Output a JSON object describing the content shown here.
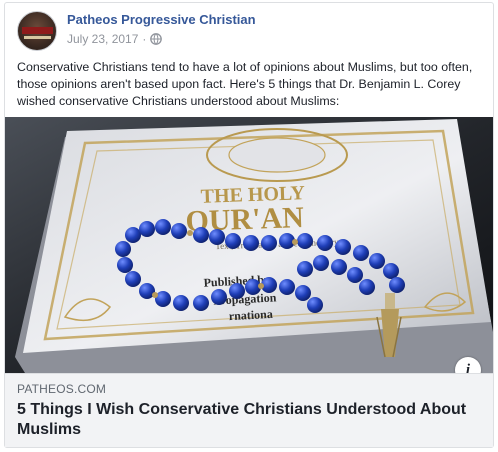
{
  "post": {
    "page_name": "Patheos Progressive Christian",
    "date": "July 23, 2017",
    "separator": "·",
    "privacy_icon": "globe-icon",
    "caption": "Conservative Christians tend to have a lot of opinions about Muslims, but too often, those opinions aren't based upon fact. Here's 5 things that Dr. Benjamin L. Corey wished conservative Christians understood about Muslims:"
  },
  "image": {
    "book_title_line1": "THE HOLY",
    "book_title_line2": "QUR'AN",
    "book_subtitle": "Text, Translation and commentary",
    "book_publisher_line1": "Published by",
    "book_publisher_line2": "Propagation",
    "book_publisher_line3": "rnationa",
    "info_label": "i"
  },
  "link": {
    "domain": "PATHEOS.COM",
    "headline": "5 Things I Wish Conservative Christians Understood About Muslims"
  },
  "colors": {
    "link_blue": "#365899",
    "meta_gray": "#90949c",
    "link_box_bg": "#f2f3f5",
    "bead_blue": "#1f3fb8"
  }
}
